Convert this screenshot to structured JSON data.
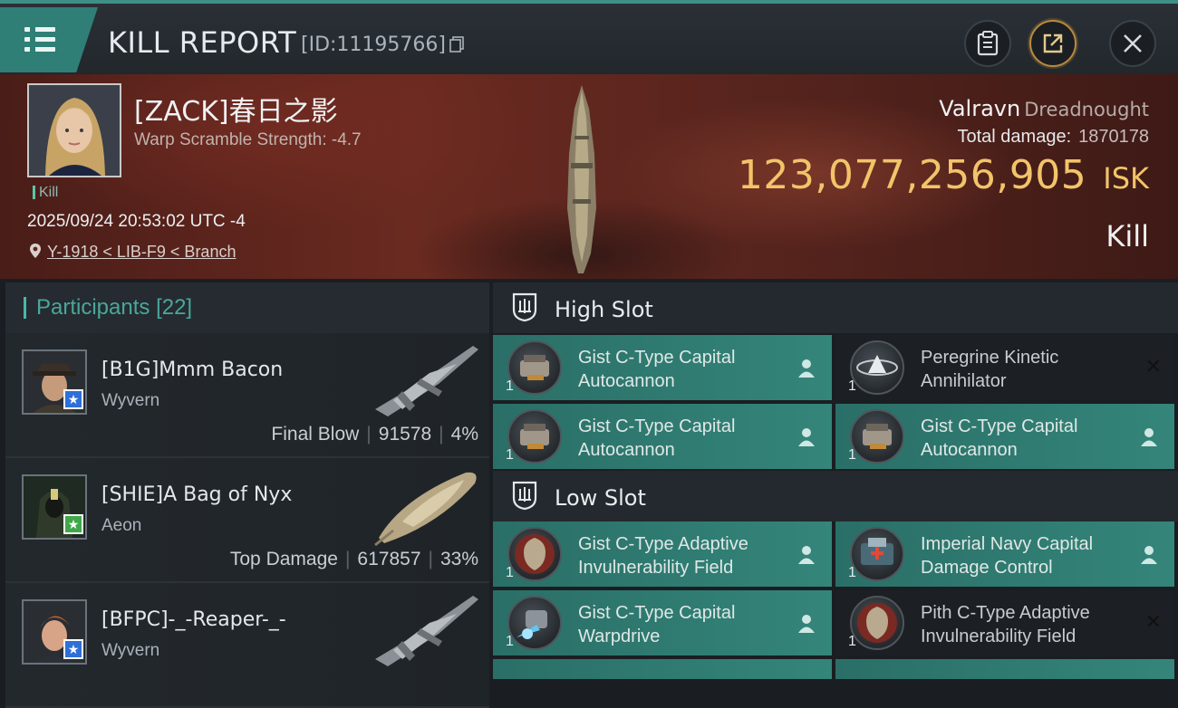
{
  "header": {
    "title": "KILL REPORT",
    "report_id": "[ID:11195766]",
    "buttons": [
      "clipboard-icon",
      "share-icon",
      "close-icon"
    ]
  },
  "victim": {
    "name": "[ZACK]春日之影",
    "warp_scramble": "Warp Scramble Strength: -4.7",
    "tag": "Kill",
    "datetime": "2025/09/24 20:53:02 UTC -4",
    "location": "Y-1918 < LIB-F9 < Branch",
    "ship_name": "Valravn",
    "ship_class": "Dreadnought",
    "total_damage_label": "Total damage:",
    "total_damage": "1870178",
    "isk_value": "123,077,256,905",
    "isk_unit": "ISK",
    "result": "Kill"
  },
  "participants": {
    "label": "Participants",
    "count": "[22]",
    "rows": [
      {
        "name": "[B1G]Mmm Bacon",
        "ship": "Wyvern",
        "role": "Final Blow",
        "damage": "91578",
        "percent": "4%",
        "badge_color": "#2f6fd8"
      },
      {
        "name": "[SHIE]A Bag of Nyx",
        "ship": "Aeon",
        "role": "Top Damage",
        "damage": "617857",
        "percent": "33%",
        "badge_color": "#3fa94a"
      },
      {
        "name": "[BFPC]-_-Reaper-_-",
        "ship": "Wyvern",
        "role": "",
        "damage": "",
        "percent": "",
        "badge_color": "#2f6fd8"
      }
    ]
  },
  "fittings": {
    "high_slot_label": "High Slot",
    "low_slot_label": "Low Slot",
    "high": [
      {
        "qty": "1",
        "name": "Gist C-Type Capital Autocannon",
        "style": "teal",
        "marker": "person"
      },
      {
        "qty": "1",
        "name": "Peregrine Kinetic Annihilator",
        "style": "dark",
        "marker": "x"
      },
      {
        "qty": "1",
        "name": "Gist C-Type Capital Autocannon",
        "style": "teal",
        "marker": "person"
      },
      {
        "qty": "1",
        "name": "Gist C-Type Capital Autocannon",
        "style": "teal",
        "marker": "person"
      }
    ],
    "low": [
      {
        "qty": "1",
        "name": "Gist C-Type Adaptive Invulnerability Field",
        "style": "teal",
        "marker": "person"
      },
      {
        "qty": "1",
        "name": "Imperial Navy Capital Damage Control",
        "style": "teal",
        "marker": "person"
      },
      {
        "qty": "1",
        "name": "Gist C-Type Capital Warpdrive",
        "style": "teal",
        "marker": "person"
      },
      {
        "qty": "1",
        "name": "Pith C-Type Adaptive Invulnerability Field",
        "style": "dark",
        "marker": "x"
      }
    ]
  }
}
